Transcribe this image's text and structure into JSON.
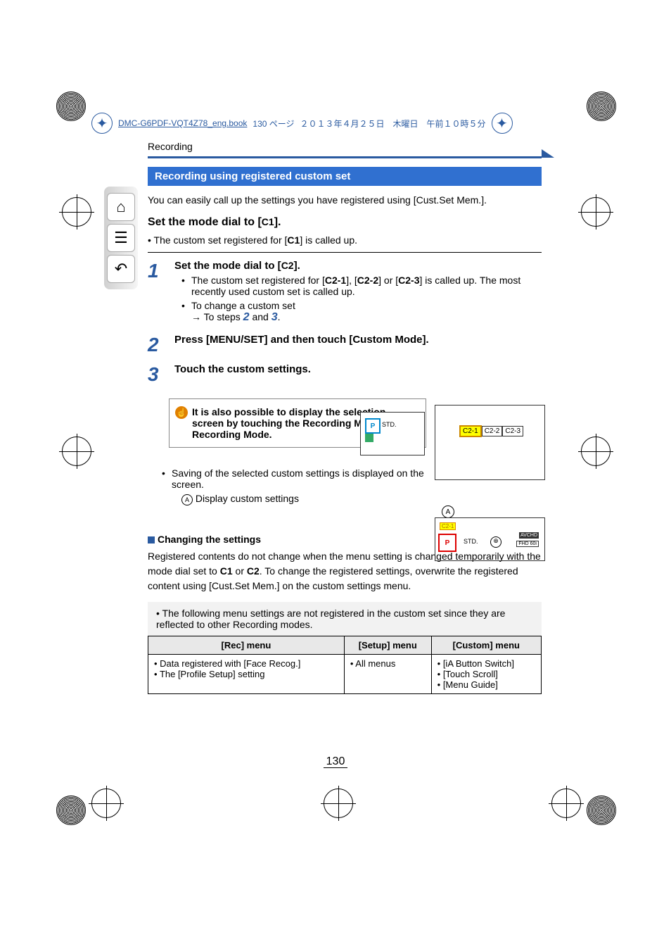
{
  "header": {
    "filename": "DMC-G6PDF-VQT4Z78_eng.book",
    "pageinfo": "130 ページ",
    "date": "２０１３年４月２５日　木曜日　午前１０時５分"
  },
  "breadcrumb": "Recording",
  "section_title": "Recording using registered custom set",
  "intro": "You can easily call up the settings you have registered using [Cust.Set Mem.].",
  "setdial_c1": {
    "title_pre": "Set the mode dial to [",
    "title_icon": "C1",
    "title_post": "].",
    "note_pre": "The custom set registered for [",
    "note_icon": "C1",
    "note_post": "] is called up."
  },
  "steps": {
    "s1": {
      "num": "1",
      "title_pre": "Set the mode dial to [",
      "title_icon": "C2",
      "title_post": "].",
      "b1_pre": "The custom set registered for [",
      "b1_c1": "C2-1",
      "b1_mid1": "], [",
      "b1_c2": "C2-2",
      "b1_mid2": "] or [",
      "b1_c3": "C2-3",
      "b1_post": "] is called up. The most recently used custom set is called up.",
      "b2": "To change a custom set",
      "b2_arrow": "→ To steps ",
      "b2_n1": "2",
      "b2_and": " and ",
      "b2_n2": "3",
      "b2_dot": "."
    },
    "s2": {
      "num": "2",
      "title": "Press [MENU/SET] and then touch [Custom Mode]."
    },
    "s3": {
      "num": "3",
      "title": "Touch the custom settings."
    }
  },
  "callout": "It is also possible to display the selection screen by touching the Recording Mode icon in Recording Mode.",
  "mini": {
    "p": "P",
    "std": "STD.",
    "c21": "C2-1",
    "c22": "C2-2",
    "c23": "C2-3"
  },
  "saving": {
    "b1": "Saving of the selected custom settings is displayed on the screen.",
    "a_label": "A",
    "a_text": "Display custom settings"
  },
  "status": {
    "p": "P",
    "std": "STD.",
    "avchd": "AVCHD",
    "fhd": "FHD 60i"
  },
  "changing": {
    "title": "Changing the settings",
    "body_pre": "Registered contents do not change when the menu setting is changed temporarily with the mode dial set to ",
    "c1": "C1",
    "or": " or ",
    "c2": "C2",
    "body_post": ". To change the registered settings, overwrite the registered content using [Cust.Set Mem.] on the custom settings menu."
  },
  "note": "The following menu settings are not registered in the custom set since they are reflected to other Recording modes.",
  "table": {
    "h1": "[Rec] menu",
    "h2": "[Setup] menu",
    "h3": "[Custom] menu",
    "c1a": "Data registered with [Face Recog.]",
    "c1b": "The [Profile Setup] setting",
    "c2a": "All menus",
    "c3a": "[iA Button Switch]",
    "c3b": "[Touch Scroll]",
    "c3c": "[Menu Guide]"
  },
  "page_number": "130"
}
